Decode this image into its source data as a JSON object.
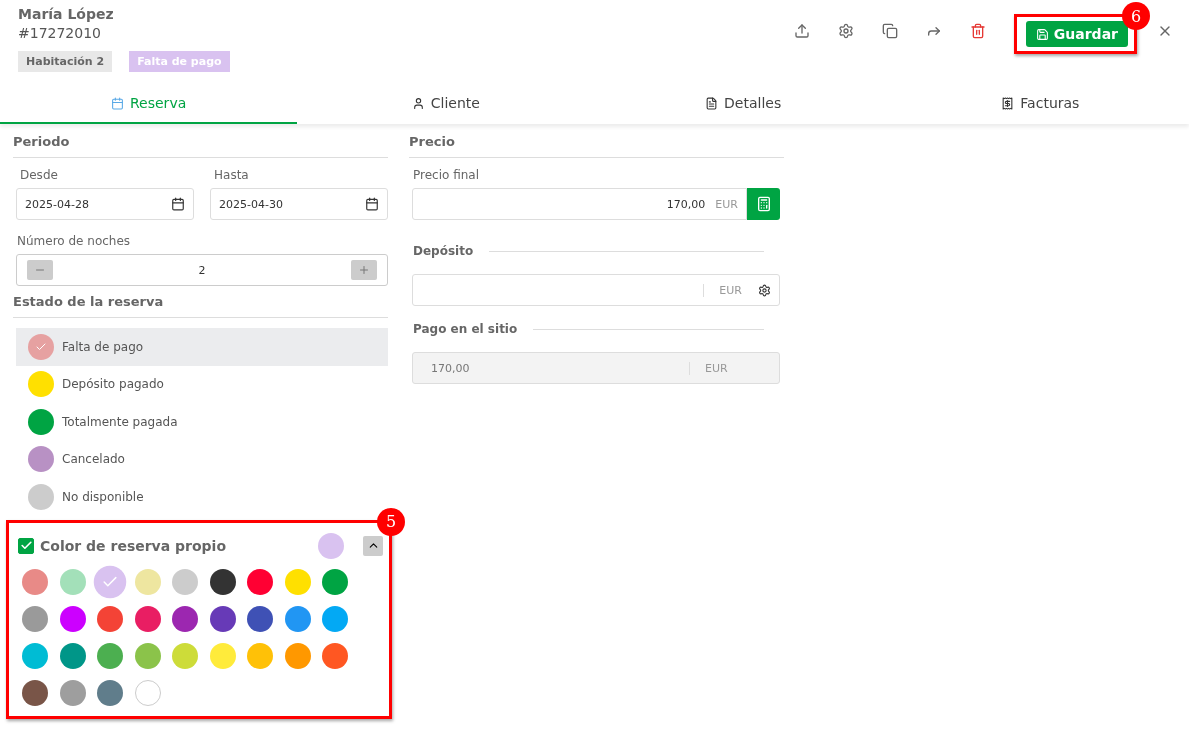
{
  "header": {
    "guest_name": "María López",
    "booking_number": "#17272010",
    "tags": [
      {
        "label": "Habitación 2",
        "color": "#e8e8e8"
      },
      {
        "label": "Falta de pago",
        "color": "#d9c2f0"
      }
    ]
  },
  "toolbar": {
    "actions": [
      {
        "kind": "upload"
      },
      {
        "kind": "settings"
      },
      {
        "kind": "copy"
      },
      {
        "kind": "forward"
      },
      {
        "kind": "delete"
      }
    ],
    "save_button": {
      "label": "Guardar",
      "callout": "6"
    }
  },
  "tabs": [
    {
      "label": "Reserva",
      "selected": true
    },
    {
      "label": "Cliente",
      "selected": false
    },
    {
      "label": "Detalles",
      "selected": false
    },
    {
      "label": "Facturas",
      "selected": false
    }
  ],
  "period": {
    "title": "Periodo",
    "from": {
      "label": "Desde",
      "value": "2025-04-28"
    },
    "to": {
      "label": "Hasta",
      "value": "2025-04-30"
    },
    "nights": {
      "label": "Número de noches",
      "value": "2"
    }
  },
  "status": {
    "title": "Estado de la reserva",
    "items": [
      {
        "label": "Falta de pago",
        "color": "#e6a1a1",
        "selected": true
      },
      {
        "label": "Depósito pagado",
        "color": "#ffe000",
        "selected": false
      },
      {
        "label": "Totalmente pagada",
        "color": "#00a443",
        "selected": false
      },
      {
        "label": "Cancelado",
        "color": "#b891c4",
        "selected": false
      },
      {
        "label": "No disponible",
        "color": "#cccccc",
        "selected": false
      }
    ]
  },
  "custom_color": {
    "label": "Color de reserva propio",
    "checked": true,
    "expanded": true,
    "callout": "5",
    "swatches": [
      {
        "color": "#e88a87",
        "selected": false
      },
      {
        "color": "#a3e0b9",
        "selected": false
      },
      {
        "color": "#d9c2f0",
        "selected": true
      },
      {
        "color": "#eee6a0",
        "selected": false
      },
      {
        "color": "#cccccc",
        "selected": false
      },
      {
        "color": "#333333",
        "selected": false
      },
      {
        "color": "#ff0033",
        "selected": false
      },
      {
        "color": "#ffe000",
        "selected": false
      },
      {
        "color": "#00a443",
        "selected": false
      },
      {
        "color": "#9a9a9a",
        "selected": false
      },
      {
        "color": "#cc00ff",
        "selected": false
      },
      {
        "color": "#f44336",
        "selected": false
      },
      {
        "color": "#e91e63",
        "selected": false
      },
      {
        "color": "#9c27b0",
        "selected": false
      },
      {
        "color": "#673ab7",
        "selected": false
      },
      {
        "color": "#3f51b5",
        "selected": false
      },
      {
        "color": "#2196f3",
        "selected": false
      },
      {
        "color": "#03a9f4",
        "selected": false
      },
      {
        "color": "#00bcd4",
        "selected": false
      },
      {
        "color": "#009688",
        "selected": false
      },
      {
        "color": "#4caf50",
        "selected": false
      },
      {
        "color": "#8bc34a",
        "selected": false
      },
      {
        "color": "#cddc39",
        "selected": false
      },
      {
        "color": "#ffeb3b",
        "selected": false
      },
      {
        "color": "#ffc107",
        "selected": false
      },
      {
        "color": "#ff9800",
        "selected": false
      },
      {
        "color": "#ff5722",
        "selected": false
      },
      {
        "color": "#795548",
        "selected": false
      },
      {
        "color": "#9e9e9e",
        "selected": false
      },
      {
        "color": "#607d8b",
        "selected": false
      },
      {
        "color": "#ffffff",
        "selected": false
      }
    ]
  },
  "price": {
    "title": "Precio",
    "final": {
      "label": "Precio final",
      "value": "170,00",
      "currency": "EUR"
    },
    "deposit": {
      "label": "Depósito",
      "currency": "EUR"
    },
    "onsite": {
      "label": "Pago en el sitio",
      "value": "170,00",
      "currency": "EUR"
    }
  }
}
